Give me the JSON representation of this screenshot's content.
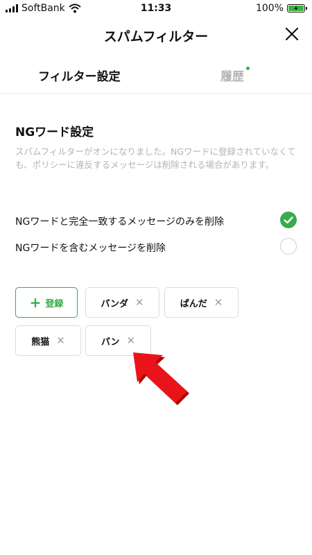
{
  "status_bar": {
    "carrier": "SoftBank",
    "time": "11:33",
    "battery": "100%"
  },
  "header": {
    "title": "スパムフィルター"
  },
  "tabs": [
    {
      "label": "フィルター設定",
      "active": true
    },
    {
      "label": "履歴",
      "active": false,
      "has_dot": true
    }
  ],
  "ng_section": {
    "title": "NGワード設定",
    "description": "スパムフィルターがオンになりました。NGワードに登録されていなくても、ポリシーに違反するメッセージは削除される場合があります。"
  },
  "options": [
    {
      "label": "NGワードと完全一致するメッセージのみを削除",
      "selected": true
    },
    {
      "label": "NGワードを含むメッセージを削除",
      "selected": false
    }
  ],
  "words": {
    "add_label": "登録",
    "items": [
      {
        "text": "パンダ"
      },
      {
        "text": "ぱんだ"
      },
      {
        "text": "熊猫"
      },
      {
        "text": "パン"
      }
    ]
  },
  "colors": {
    "accent": "#3aaa4a",
    "battery_fill": "#3cb33c",
    "annotation_arrow": "#e8141a"
  },
  "icons": [
    "signal-icon",
    "wifi-icon",
    "battery-icon",
    "close-icon",
    "plus-icon",
    "check-icon",
    "remove-icon",
    "annotation-arrow"
  ]
}
